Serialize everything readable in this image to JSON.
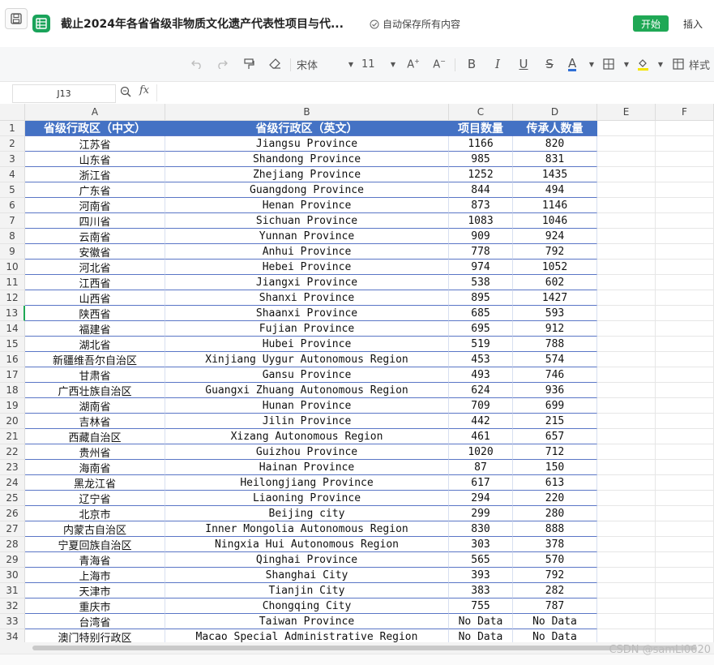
{
  "app": {
    "doc_title": "截止2024年各省省级非物质文化遗产代表性项目与代...",
    "autosave_text": "自动保存所有内容",
    "start_label": "开始",
    "insert_label": "插入",
    "accent_color": "#1fa855",
    "header_fill": "#4472c4"
  },
  "toolbar": {
    "undo_icon": "undo-icon",
    "redo_icon": "redo-icon",
    "font_name": "宋体",
    "font_size": "11",
    "bold": "B",
    "italic": "I",
    "underline": "U",
    "strike": "S",
    "font_color": "A",
    "styles_label": "样式"
  },
  "formula_bar": {
    "name_box": "J13",
    "fx_label": "fx"
  },
  "columns": [
    "A",
    "B",
    "C",
    "D",
    "E",
    "F"
  ],
  "selected_row": 13,
  "table": {
    "headers": [
      "省级行政区（中文）",
      "省级行政区（英文）",
      "项目数量",
      "传承人数量"
    ],
    "rows": [
      [
        "江苏省",
        "Jiangsu Province",
        "1166",
        "820"
      ],
      [
        "山东省",
        "Shandong Province",
        "985",
        "831"
      ],
      [
        "浙江省",
        "Zhejiang Province",
        "1252",
        "1435"
      ],
      [
        "广东省",
        "Guangdong Province",
        "844",
        "494"
      ],
      [
        "河南省",
        "Henan Province",
        "873",
        "1146"
      ],
      [
        "四川省",
        "Sichuan Province",
        "1083",
        "1046"
      ],
      [
        "云南省",
        "Yunnan Province",
        "909",
        "924"
      ],
      [
        "安徽省",
        "Anhui Province",
        "778",
        "792"
      ],
      [
        "河北省",
        "Hebei Province",
        "974",
        "1052"
      ],
      [
        "江西省",
        "Jiangxi Province",
        "538",
        "602"
      ],
      [
        "山西省",
        "Shanxi Province",
        "895",
        "1427"
      ],
      [
        "陕西省",
        "Shaanxi Province",
        "685",
        "593"
      ],
      [
        "福建省",
        "Fujian Province",
        "695",
        "912"
      ],
      [
        "湖北省",
        "Hubei Province",
        "519",
        "788"
      ],
      [
        "新疆维吾尔自治区",
        "Xinjiang Uygur Autonomous Region",
        "453",
        "574"
      ],
      [
        "甘肃省",
        "Gansu Province",
        "493",
        "746"
      ],
      [
        "广西壮族自治区",
        "Guangxi Zhuang Autonomous Region",
        "624",
        "936"
      ],
      [
        "湖南省",
        "Hunan Province",
        "709",
        "699"
      ],
      [
        "吉林省",
        "Jilin Province",
        "442",
        "215"
      ],
      [
        "西藏自治区",
        "Xizang Autonomous Region",
        "461",
        "657"
      ],
      [
        "贵州省",
        "Guizhou Province",
        "1020",
        "712"
      ],
      [
        "海南省",
        "Hainan Province",
        "87",
        "150"
      ],
      [
        "黑龙江省",
        "Heilongjiang Province",
        "617",
        "613"
      ],
      [
        "辽宁省",
        "Liaoning Province",
        "294",
        "220"
      ],
      [
        "北京市",
        "Beijing city",
        "299",
        "280"
      ],
      [
        "内蒙古自治区",
        "Inner Mongolia Autonomous Region",
        "830",
        "888"
      ],
      [
        "宁夏回族自治区",
        "Ningxia Hui Autonomous Region",
        "303",
        "378"
      ],
      [
        "青海省",
        "Qinghai Province",
        "565",
        "570"
      ],
      [
        "上海市",
        "Shanghai City",
        "393",
        "792"
      ],
      [
        "天津市",
        "Tianjin City",
        "383",
        "282"
      ],
      [
        "重庆市",
        "Chongqing City",
        "755",
        "787"
      ],
      [
        "台湾省",
        "Taiwan Province",
        "No Data",
        "No Data"
      ],
      [
        "澳门特别行政区",
        "Macao Special Administrative Region",
        "No Data",
        "No Data"
      ]
    ]
  },
  "watermark": "CSDN @samLi0620"
}
